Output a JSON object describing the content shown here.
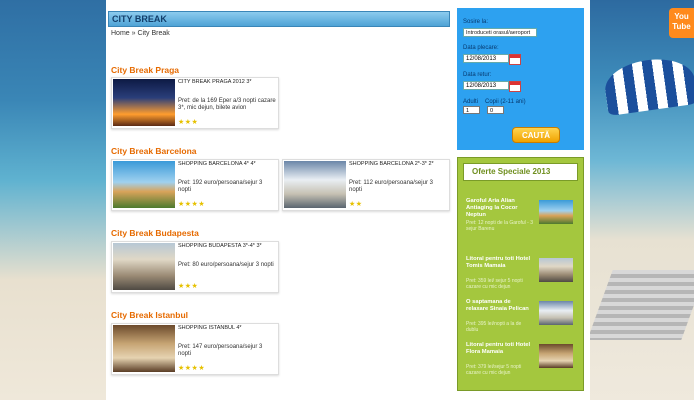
{
  "social": {
    "youtube_label": "You Tube"
  },
  "main": {
    "title": "CITY BREAK",
    "breadcrumb": "Home » City Break",
    "sections": [
      {
        "heading": "City Break Praga",
        "cards": [
          {
            "title": "CITY BREAK PRAGA 2012 3*",
            "price": "Pret: de la 169 Eper a/3 nopti cazare 3*, mic dejun, bilete avion",
            "stars": "★★★"
          }
        ]
      },
      {
        "heading": "City Break Barcelona",
        "cards": [
          {
            "title": "SHOPPING BARCELONA 4* 4*",
            "price": "Pret: 192 euro/persoana/sejur 3 nopti",
            "stars": "★★★★"
          },
          {
            "title": "SHOPPING BARCELONA 2*-3* 2*",
            "price": "Pret: 112 euro/persoana/sejur 3 nopti",
            "stars": "★★"
          }
        ]
      },
      {
        "heading": "City Break Budapesta",
        "cards": [
          {
            "title": "SHOPPING BUDAPESTA 3*-4* 3*",
            "price": "Pret: 80 euro/persoana/sejur 3 nopti",
            "stars": "★★★"
          }
        ]
      },
      {
        "heading": "City Break Istanbul",
        "cards": [
          {
            "title": "SHOPPING ISTANBUL 4*",
            "price": "Pret: 147 euro/persoana/sejur 3 nopti",
            "stars": "★★★★"
          }
        ]
      }
    ]
  },
  "search": {
    "dest_label": "Sosire la:",
    "dest_value": "Introduceti orasul/aeroport",
    "checkin_label": "Data plecare:",
    "checkin_value": "12/08/2013",
    "checkout_label": "Data retur:",
    "checkout_value": "12/08/2013",
    "adults_label": "Adulti",
    "adults_value": "1",
    "children_label": "Copii (2-11 ani)",
    "children_value": "0",
    "button": "CAUTĂ"
  },
  "offers": {
    "title": "Oferte Speciale 2013",
    "items": [
      {
        "title": "Garoful Aria Alian Antiaging la Cocor Neptun",
        "price": "Pret: 12 nopti de la Garoful - 3 sejur Barenu"
      },
      {
        "title": "Litoral pentru toti Hotel Tomis Mamaia",
        "price": "Pret: 359 lei/ sejur 5 nopti cazare cu mic dejun"
      },
      {
        "title": "O saptamana de relaxare Sinaia Pelican",
        "price": "Pret: 395 lei/nopti a la de dublu"
      },
      {
        "title": "Litoral pentru toti Hotel Flora Mamaia",
        "price": "Pret: 379 lei/sejur 5 nopti cazare cu mic dejun"
      }
    ]
  }
}
